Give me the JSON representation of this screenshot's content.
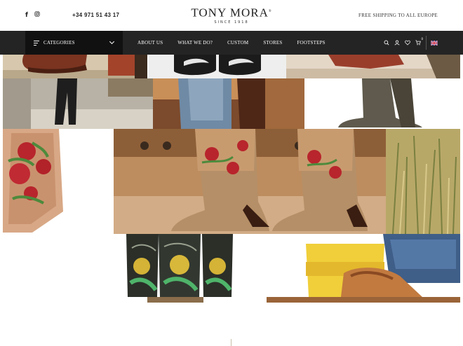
{
  "header": {
    "social": [
      {
        "name": "facebook",
        "glyph": "f"
      },
      {
        "name": "instagram",
        "glyph": "◎"
      }
    ],
    "phone": "+34 971 51 43 17",
    "brand": {
      "name": "TONY MORA",
      "registered": "®",
      "since": "SINCE 1918"
    },
    "shipping": "FREE SHIPPING TO ALL EUROPE"
  },
  "nav": {
    "categories_label": "CATEGORIES",
    "menu": [
      {
        "id": "about",
        "label": "ABOUT US"
      },
      {
        "id": "whatwedo",
        "label": "WHAT WE DO?"
      },
      {
        "id": "custom",
        "label": "CUSTOM"
      },
      {
        "id": "stores",
        "label": "STORES"
      },
      {
        "id": "footsteps",
        "label": "FOOTSTEPS"
      }
    ],
    "cart_count": "0",
    "language_flag": "uk-flag"
  },
  "colors": {
    "nav_bg": "#242424",
    "categories_bg": "#111111",
    "text": "#222222"
  }
}
